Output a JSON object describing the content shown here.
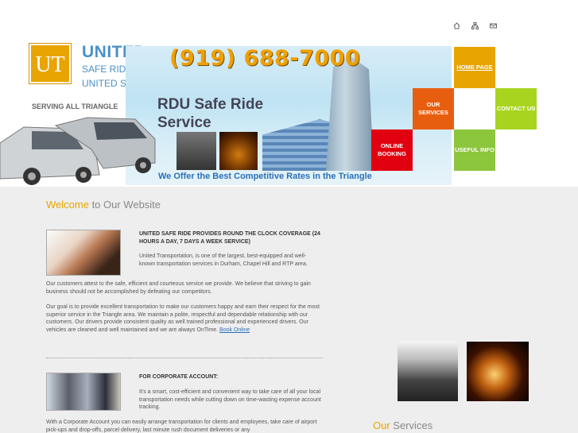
{
  "header": {
    "logo_text": "UT",
    "brand_name": "UNITED",
    "brand_sub1": "SAFE RIDE",
    "brand_sub2": "UNITED SAFE RIDE",
    "phone": "(919) 688-7000",
    "banner_title": "RDU Safe Ride Service",
    "serving": "SERVING ALL TRIANGLE",
    "tagline": "We Offer the Best Competitive Rates in the Triangle",
    "top_icons": [
      "home-icon",
      "sitemap-icon",
      "mail-icon"
    ]
  },
  "nav": {
    "home": "HOME PAGE",
    "services": "OUR SERVICES",
    "contact": "CONTACT US",
    "booking": "ONLINE BOOKING",
    "useful": "USEFUL INFO"
  },
  "content": {
    "welcome_highlight": "Welcome",
    "welcome_rest": " to Our Website",
    "heading1": "UNITED SAFE RIDE PROVIDES ROUND THE CLOCK COVERAGE (24 HOURS A DAY, 7 DAYS A WEEK SERVICE)",
    "para1": "United Transportation, is one of the largest, best-equipped and well-known transportation services in Durham, Chapel Hill and RTP area.",
    "para2": "Our customers attest to the safe, efficient and courteous service we provide. We believe that striving to gain business should not be accomplished by defeating our competitors.",
    "para3": "Our goal is to provide excellent transportation to make our customers happy and earn their respect for the most superior service in the Triangle area. We maintain a polite, respectful and dependable relationship with our customers. Our drivers provide consistent quality as well trained professional and experienced drivers. Our vehicles are cleaned and well maintained and we are always OnTime. ",
    "book_online": "Book Online",
    "heading2": "FOR CORPORATE ACCOUNT:",
    "para4": "It's a smart, cost-efficient and convenient way to take care of all your local transportation needs while cutting down on time-wasting expense account tracking.",
    "para5": "With a Corporate Account you can easily arrange transportation for clients and employees, take care of airport pick-ups and drop-offs, parcel delivery, last minute rush document deliveries or any",
    "services_highlight": "Our",
    "services_rest": " Services"
  },
  "colors": {
    "orange": "#e8a400",
    "red_orange": "#e85e10",
    "lime": "#a8d420",
    "red": "#e00010",
    "green": "#8cc63c",
    "link_blue": "#2a6fb8"
  }
}
